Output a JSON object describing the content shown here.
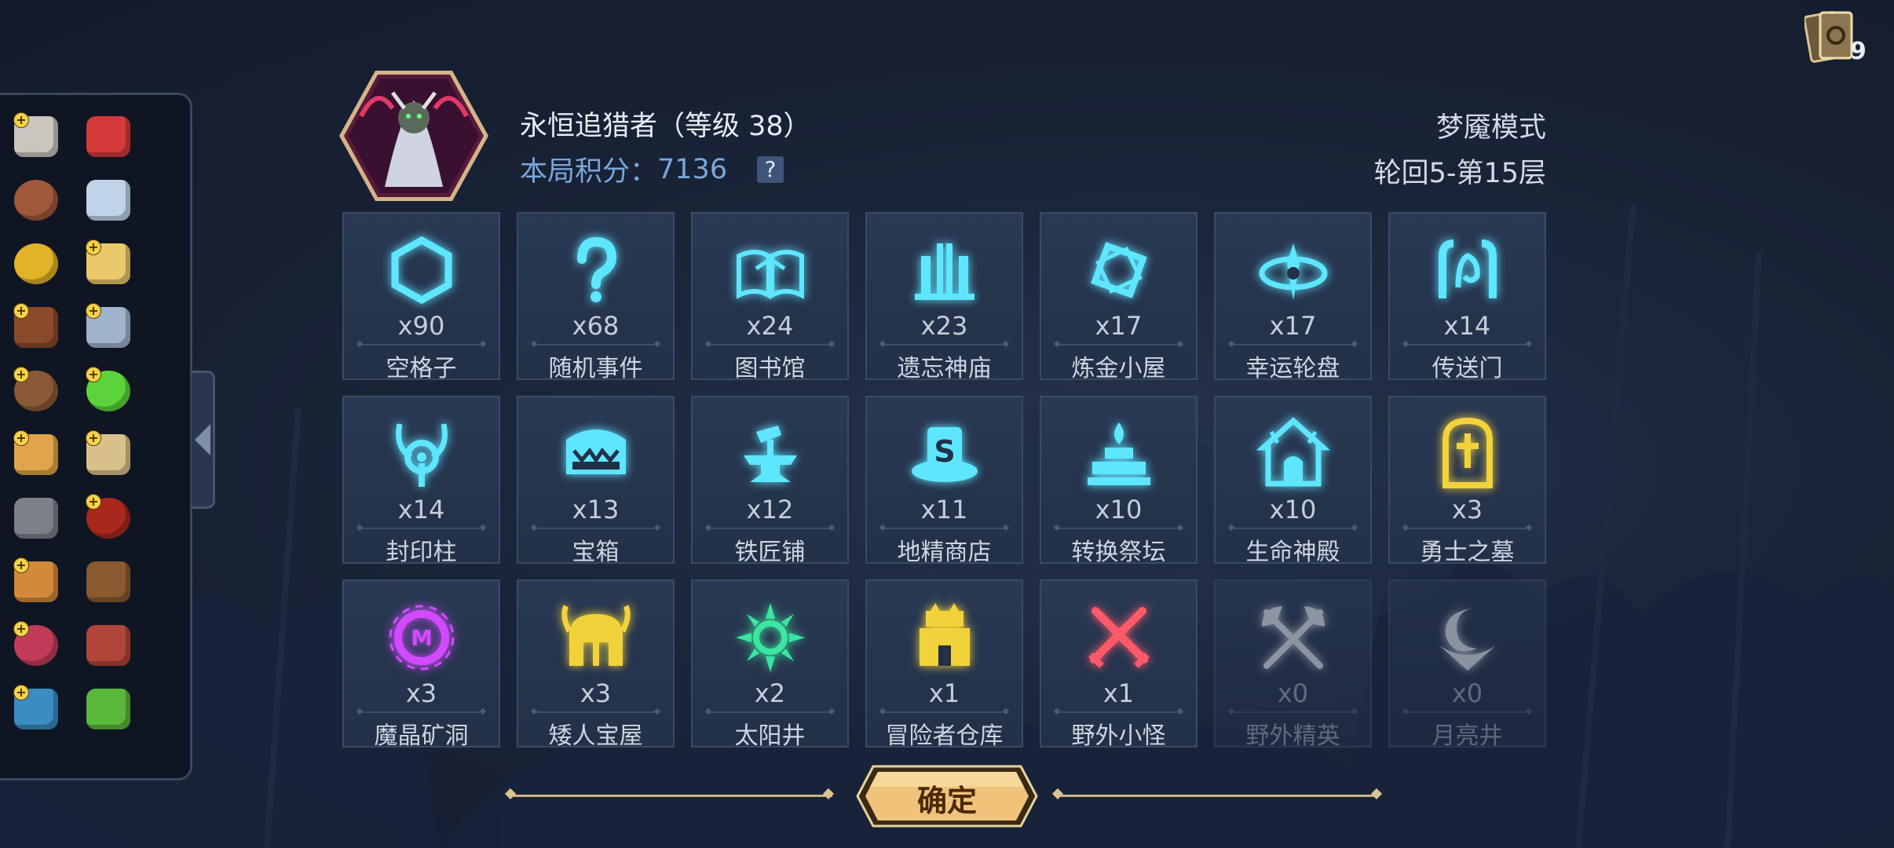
{
  "header": {
    "character_name": "永恒追猎者（等级 38）",
    "score_label": "本局积分：",
    "score_value": "7136",
    "help_label": "?",
    "mode": "梦魇模式",
    "floor": "轮回5-第15层"
  },
  "deck": {
    "count": "9",
    "icon": "card-deck-icon"
  },
  "inventory": {
    "items": [
      {
        "icon": "stone-block-icon",
        "color": "#c9c6c0",
        "plus": "+"
      },
      {
        "icon": "meat-leg-icon",
        "color": "#d43a3a",
        "plus": ""
      },
      {
        "icon": "clay-pot-icon",
        "color": "#a0583a",
        "plus": ""
      },
      {
        "icon": "pendant-icon",
        "color": "#bfd4e8",
        "plus": ""
      },
      {
        "icon": "gold-coin-icon",
        "color": "#e2b227",
        "plus": ""
      },
      {
        "icon": "treasure-pile-icon",
        "color": "#e9c96a",
        "plus": "+"
      },
      {
        "icon": "spell-book-icon",
        "color": "#8a4a2a",
        "plus": "+"
      },
      {
        "icon": "card-icon",
        "color": "#9fb3cc",
        "plus": "+"
      },
      {
        "icon": "barrel-icon",
        "color": "#8a5a36",
        "plus": "+"
      },
      {
        "icon": "potion-icon",
        "color": "#5ad43a",
        "plus": "+"
      },
      {
        "icon": "palette-icon",
        "color": "#e0a44a",
        "plus": "+"
      },
      {
        "icon": "scroll-icon",
        "color": "#d9c08a",
        "plus": "+"
      },
      {
        "icon": "tongs-icon",
        "color": "#7c8088",
        "plus": ""
      },
      {
        "icon": "red-orb-icon",
        "color": "#a8281e",
        "plus": "+"
      },
      {
        "icon": "chest-icon",
        "color": "#d28a3a",
        "plus": "+"
      },
      {
        "icon": "belt-icon",
        "color": "#8a5a30",
        "plus": ""
      },
      {
        "icon": "fruit-bowl-icon",
        "color": "#c23c5a",
        "plus": "+"
      },
      {
        "icon": "ham-icon",
        "color": "#b2453a",
        "plus": ""
      },
      {
        "icon": "blue-cloth-icon",
        "color": "#3a8cc2",
        "plus": "+"
      },
      {
        "icon": "green-goblet-icon",
        "color": "#5ab83a",
        "plus": ""
      }
    ]
  },
  "tiles": [
    {
      "count": "x90",
      "label": "空格子",
      "icon": "hexagon-icon",
      "color": "#5fe6ff"
    },
    {
      "count": "x68",
      "label": "随机事件",
      "icon": "question-mark-icon",
      "color": "#5fe6ff"
    },
    {
      "count": "x24",
      "label": "图书馆",
      "icon": "open-book-icon",
      "color": "#5fe6ff"
    },
    {
      "count": "x23",
      "label": "遗忘神庙",
      "icon": "temple-pillars-icon",
      "color": "#5fe6ff"
    },
    {
      "count": "x17",
      "label": "炼金小屋",
      "icon": "alchemy-diamond-icon",
      "color": "#5fe6ff"
    },
    {
      "count": "x17",
      "label": "幸运轮盘",
      "icon": "roulette-icon",
      "color": "#5fe6ff"
    },
    {
      "count": "x14",
      "label": "传送门",
      "icon": "portal-icon",
      "color": "#5fe6ff"
    },
    {
      "count": "x14",
      "label": "封印柱",
      "icon": "seal-pillar-icon",
      "color": "#5fe6ff"
    },
    {
      "count": "x13",
      "label": "宝箱",
      "icon": "mimic-chest-icon",
      "color": "#5fe6ff"
    },
    {
      "count": "x12",
      "label": "铁匠铺",
      "icon": "anvil-icon",
      "color": "#5fe6ff"
    },
    {
      "count": "x11",
      "label": "地精商店",
      "icon": "goblin-hat-icon",
      "color": "#5fe6ff"
    },
    {
      "count": "x10",
      "label": "转换祭坛",
      "icon": "altar-icon",
      "color": "#5fe6ff"
    },
    {
      "count": "x10",
      "label": "生命神殿",
      "icon": "life-shrine-icon",
      "color": "#5fe6ff"
    },
    {
      "count": "x3",
      "label": "勇士之墓",
      "icon": "tombstone-icon",
      "color": "#f2d23a"
    },
    {
      "count": "x3",
      "label": "魔晶矿洞",
      "icon": "crystal-mine-icon",
      "color": "#d24aff"
    },
    {
      "count": "x3",
      "label": "矮人宝屋",
      "icon": "dwarf-helmet-icon",
      "color": "#f2d23a"
    },
    {
      "count": "x2",
      "label": "太阳井",
      "icon": "sun-well-icon",
      "color": "#3ae6a0"
    },
    {
      "count": "x1",
      "label": "冒险者仓库",
      "icon": "warehouse-icon",
      "color": "#f2d23a"
    },
    {
      "count": "x1",
      "label": "野外小怪",
      "icon": "crossed-swords-icon",
      "color": "#ff5a6a"
    },
    {
      "count": "x0",
      "label": "野外精英",
      "icon": "crossed-axes-icon",
      "color": "#e8ecf2"
    },
    {
      "count": "x0",
      "label": "月亮井",
      "icon": "moon-well-icon",
      "color": "#e8ecf2"
    }
  ],
  "confirm": {
    "label": "确定"
  }
}
